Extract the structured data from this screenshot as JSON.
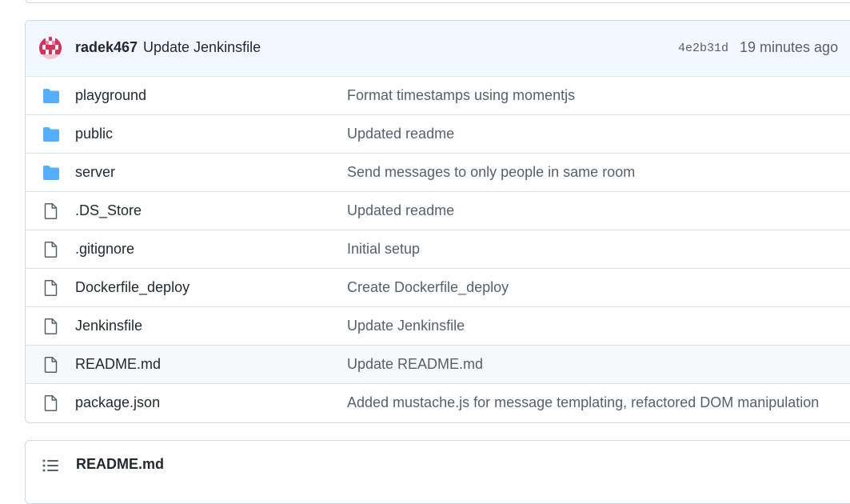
{
  "commit": {
    "author": "radek467",
    "message": "Update Jenkinsfile",
    "sha": "4e2b31d",
    "age": "19 minutes ago"
  },
  "files": [
    {
      "name": "playground",
      "type": "folder",
      "message": "Format timestamps using momentjs"
    },
    {
      "name": "public",
      "type": "folder",
      "message": "Updated readme"
    },
    {
      "name": "server",
      "type": "folder",
      "message": "Send messages to only people in same room"
    },
    {
      "name": ".DS_Store",
      "type": "file",
      "message": "Updated readme"
    },
    {
      "name": ".gitignore",
      "type": "file",
      "message": "Initial setup"
    },
    {
      "name": "Dockerfile_deploy",
      "type": "file",
      "message": "Create Dockerfile_deploy"
    },
    {
      "name": "Jenkinsfile",
      "type": "file",
      "message": "Update Jenkinsfile"
    },
    {
      "name": "README.md",
      "type": "file",
      "message": "Update README.md"
    },
    {
      "name": "package.json",
      "type": "file",
      "message": "Added mustache.js for message templating, refactored DOM manipulation"
    }
  ],
  "readme": {
    "title": "README.md"
  },
  "colors": {
    "folder": "#54aeff",
    "file": "#57606a",
    "header_bg": "#f1f8ff",
    "avatar": "#d6325b"
  }
}
